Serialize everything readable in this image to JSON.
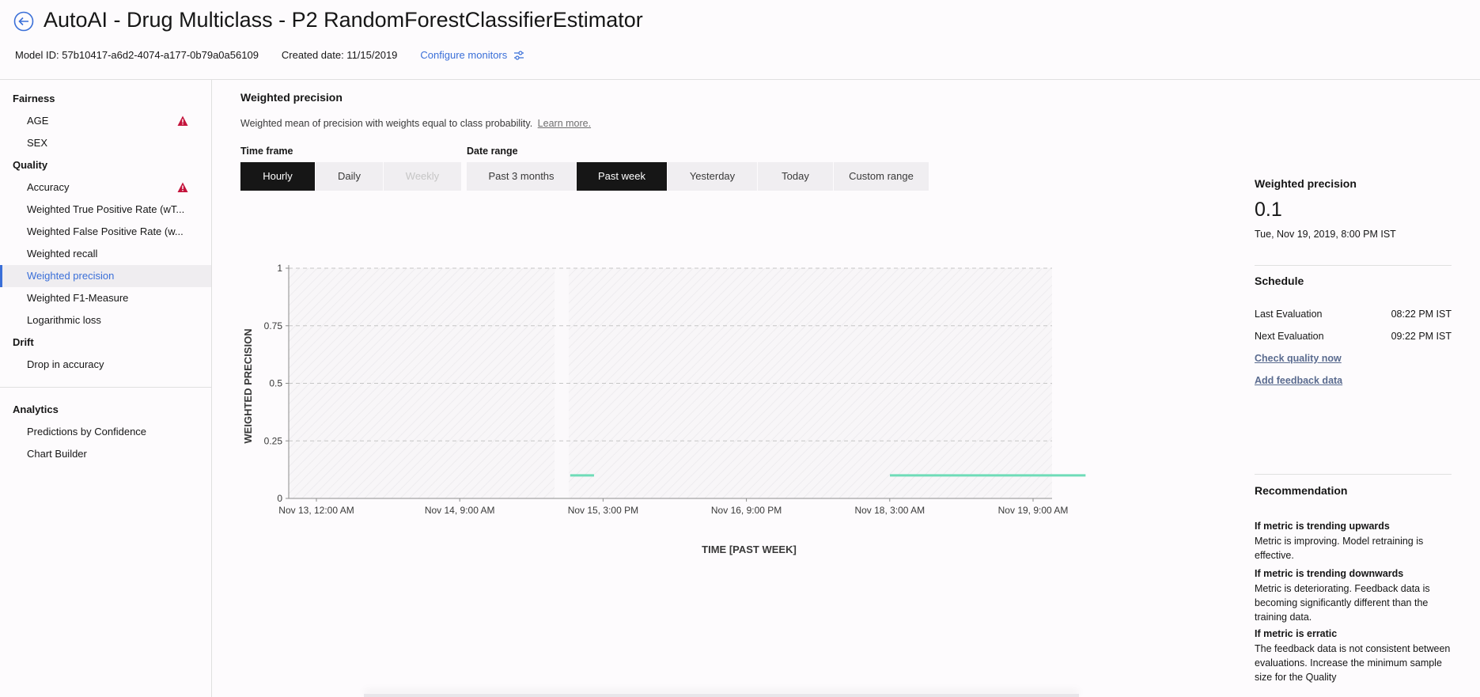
{
  "header": {
    "title": "AutoAI - Drug Multiclass - P2 RandomForestClassifierEstimator",
    "model_id": "Model ID: 57b10417-a6d2-4074-a177-0b79a0a56109",
    "created": "Created date: 11/15/2019",
    "configure_label": "Configure monitors"
  },
  "sidebar": {
    "fairness": "Fairness",
    "age": "AGE",
    "sex": "SEX",
    "quality": "Quality",
    "accuracy": "Accuracy",
    "wtpr": "Weighted True Positive Rate (wT...",
    "wfpr": "Weighted False Positive Rate (w...",
    "wrecall": "Weighted recall",
    "wprecision": "Weighted precision",
    "wf1": "Weighted F1-Measure",
    "logloss": "Logarithmic loss",
    "drift": "Drift",
    "drop": "Drop in accuracy",
    "analytics": "Analytics",
    "predictions": "Predictions by Confidence",
    "builder": "Chart Builder"
  },
  "main": {
    "title": "Weighted precision",
    "description": "Weighted mean of precision with weights equal to class probability.",
    "learn_more": "Learn more.",
    "time_frame_label": "Time frame",
    "date_range_label": "Date range",
    "time_frame": {
      "hourly": "Hourly",
      "daily": "Daily",
      "weekly": "Weekly"
    },
    "date_range": {
      "past3": "Past 3 months",
      "pastweek": "Past week",
      "yesterday": "Yesterday",
      "today": "Today",
      "custom": "Custom range"
    }
  },
  "chart_data": {
    "type": "line",
    "ylabel": "WEIGHTED PRECISION",
    "xlabel": "TIME [PAST WEEK]",
    "ylim": [
      0,
      1
    ],
    "yticks": [
      "0",
      "0.25",
      "0.5",
      "0.75",
      "1"
    ],
    "xticks": [
      "Nov 13, 12:00 AM",
      "Nov 14, 9:00 AM",
      "Nov 15, 3:00 PM",
      "Nov 16, 9:00 PM",
      "Nov 18, 3:00 AM",
      "Nov 19, 9:00 AM"
    ],
    "grid": true,
    "color": "#6fdcb8",
    "series": [
      {
        "segments": [
          {
            "x": [
              "Nov 15, 2019 8:00 AM",
              "Nov 15, 2019 1:00 PM"
            ],
            "y": [
              0.1,
              0.1
            ]
          },
          {
            "x": [
              "Nov 18, 2019 3:00 AM",
              "Nov 19, 2019 8:00 PM"
            ],
            "y": [
              0.1,
              0.1
            ]
          }
        ]
      }
    ]
  },
  "panel": {
    "metric_title": "Weighted precision",
    "value": "0.1",
    "date": "Tue, Nov 19, 2019, 8:00 PM IST",
    "schedule_title": "Schedule",
    "last_eval_label": "Last Evaluation",
    "last_eval_value": "08:22 PM IST",
    "next_eval_label": "Next Evaluation",
    "next_eval_value": "09:22 PM IST",
    "check_quality": "Check quality now",
    "add_feedback": "Add feedback data",
    "recommendation_title": "Recommendation",
    "up_head": "If metric is trending upwards",
    "up_body": "Metric is improving. Model retraining is effective.",
    "down_head": "If metric is trending downwards",
    "down_body": "Metric is deteriorating. Feedback data is becoming significantly different than the training data.",
    "erratic_head": "If metric is erratic",
    "erratic_body": "The feedback data is not consistent between evaluations. Increase the minimum sample size for the Quality"
  }
}
